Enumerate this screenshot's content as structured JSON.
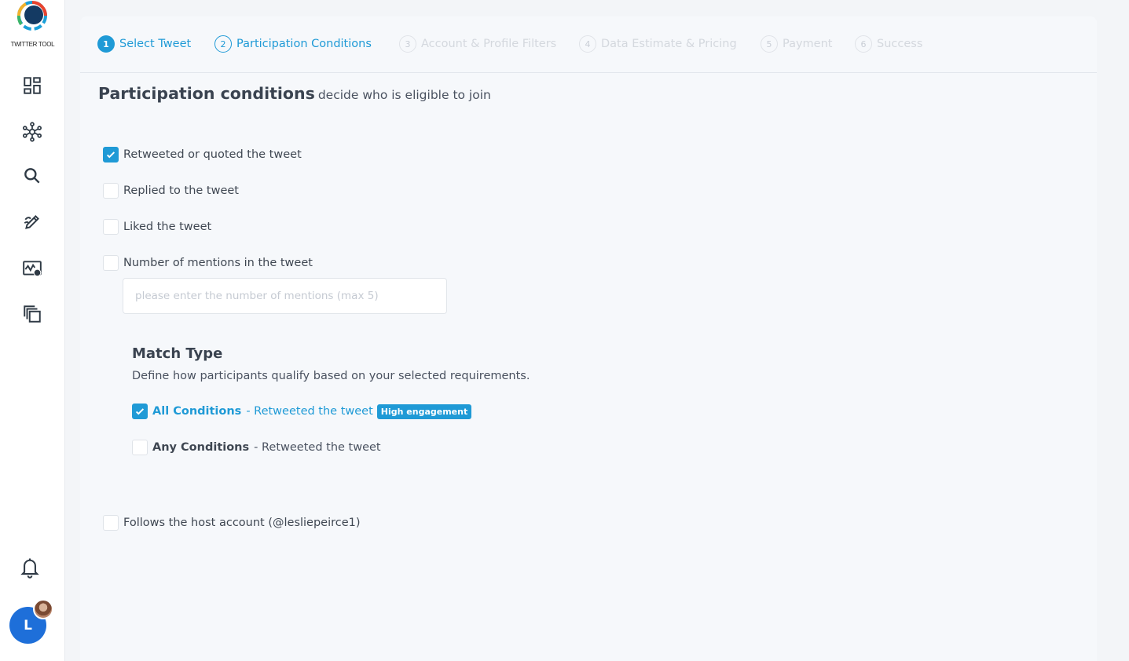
{
  "app": {
    "brand": "TWITTER TOOL"
  },
  "sidebar": {
    "items": [
      {
        "icon": "dashboard-icon"
      },
      {
        "icon": "network-icon"
      },
      {
        "icon": "search-icon"
      },
      {
        "icon": "edit-icon"
      },
      {
        "icon": "analytics-icon"
      },
      {
        "icon": "copy-icon"
      }
    ],
    "notifications_icon": "bell-icon",
    "avatar_initial": "L"
  },
  "stepper": {
    "steps": [
      {
        "num": "1",
        "label": "Select Tweet",
        "state": "done"
      },
      {
        "num": "2",
        "label": "Participation Conditions",
        "state": "active"
      },
      {
        "num": "3",
        "label": "Account & Profile Filters",
        "state": "pending"
      },
      {
        "num": "4",
        "label": "Data Estimate & Pricing",
        "state": "pending"
      },
      {
        "num": "5",
        "label": "Payment",
        "state": "pending"
      },
      {
        "num": "6",
        "label": "Success",
        "state": "pending"
      }
    ]
  },
  "heading": {
    "strong": "Participation conditions",
    "rest": "decide who is eligible to join"
  },
  "conditions": [
    {
      "label": "Retweeted or quoted the tweet",
      "checked": true
    },
    {
      "label": "Replied to the tweet",
      "checked": false
    },
    {
      "label": "Liked the tweet",
      "checked": false
    },
    {
      "label": "Number of mentions in the tweet",
      "checked": false
    }
  ],
  "mentions_input": {
    "placeholder": "please enter the number of mentions (max 5)",
    "value": ""
  },
  "match_type": {
    "title": "Match Type",
    "description": "Define how participants qualify based on your selected requirements.",
    "all": {
      "strong": "All Conditions",
      "rest": "- Retweeted the tweet",
      "badge": "High engagement",
      "checked": true
    },
    "any": {
      "strong": "Any Conditions",
      "rest": "- Retweeted the tweet",
      "checked": false
    }
  },
  "follows": {
    "label": "Follows the host account (@lesliepeirce1)",
    "checked": false
  },
  "colors": {
    "accent": "#1f9ad6",
    "avatar": "#1e6fd9"
  }
}
